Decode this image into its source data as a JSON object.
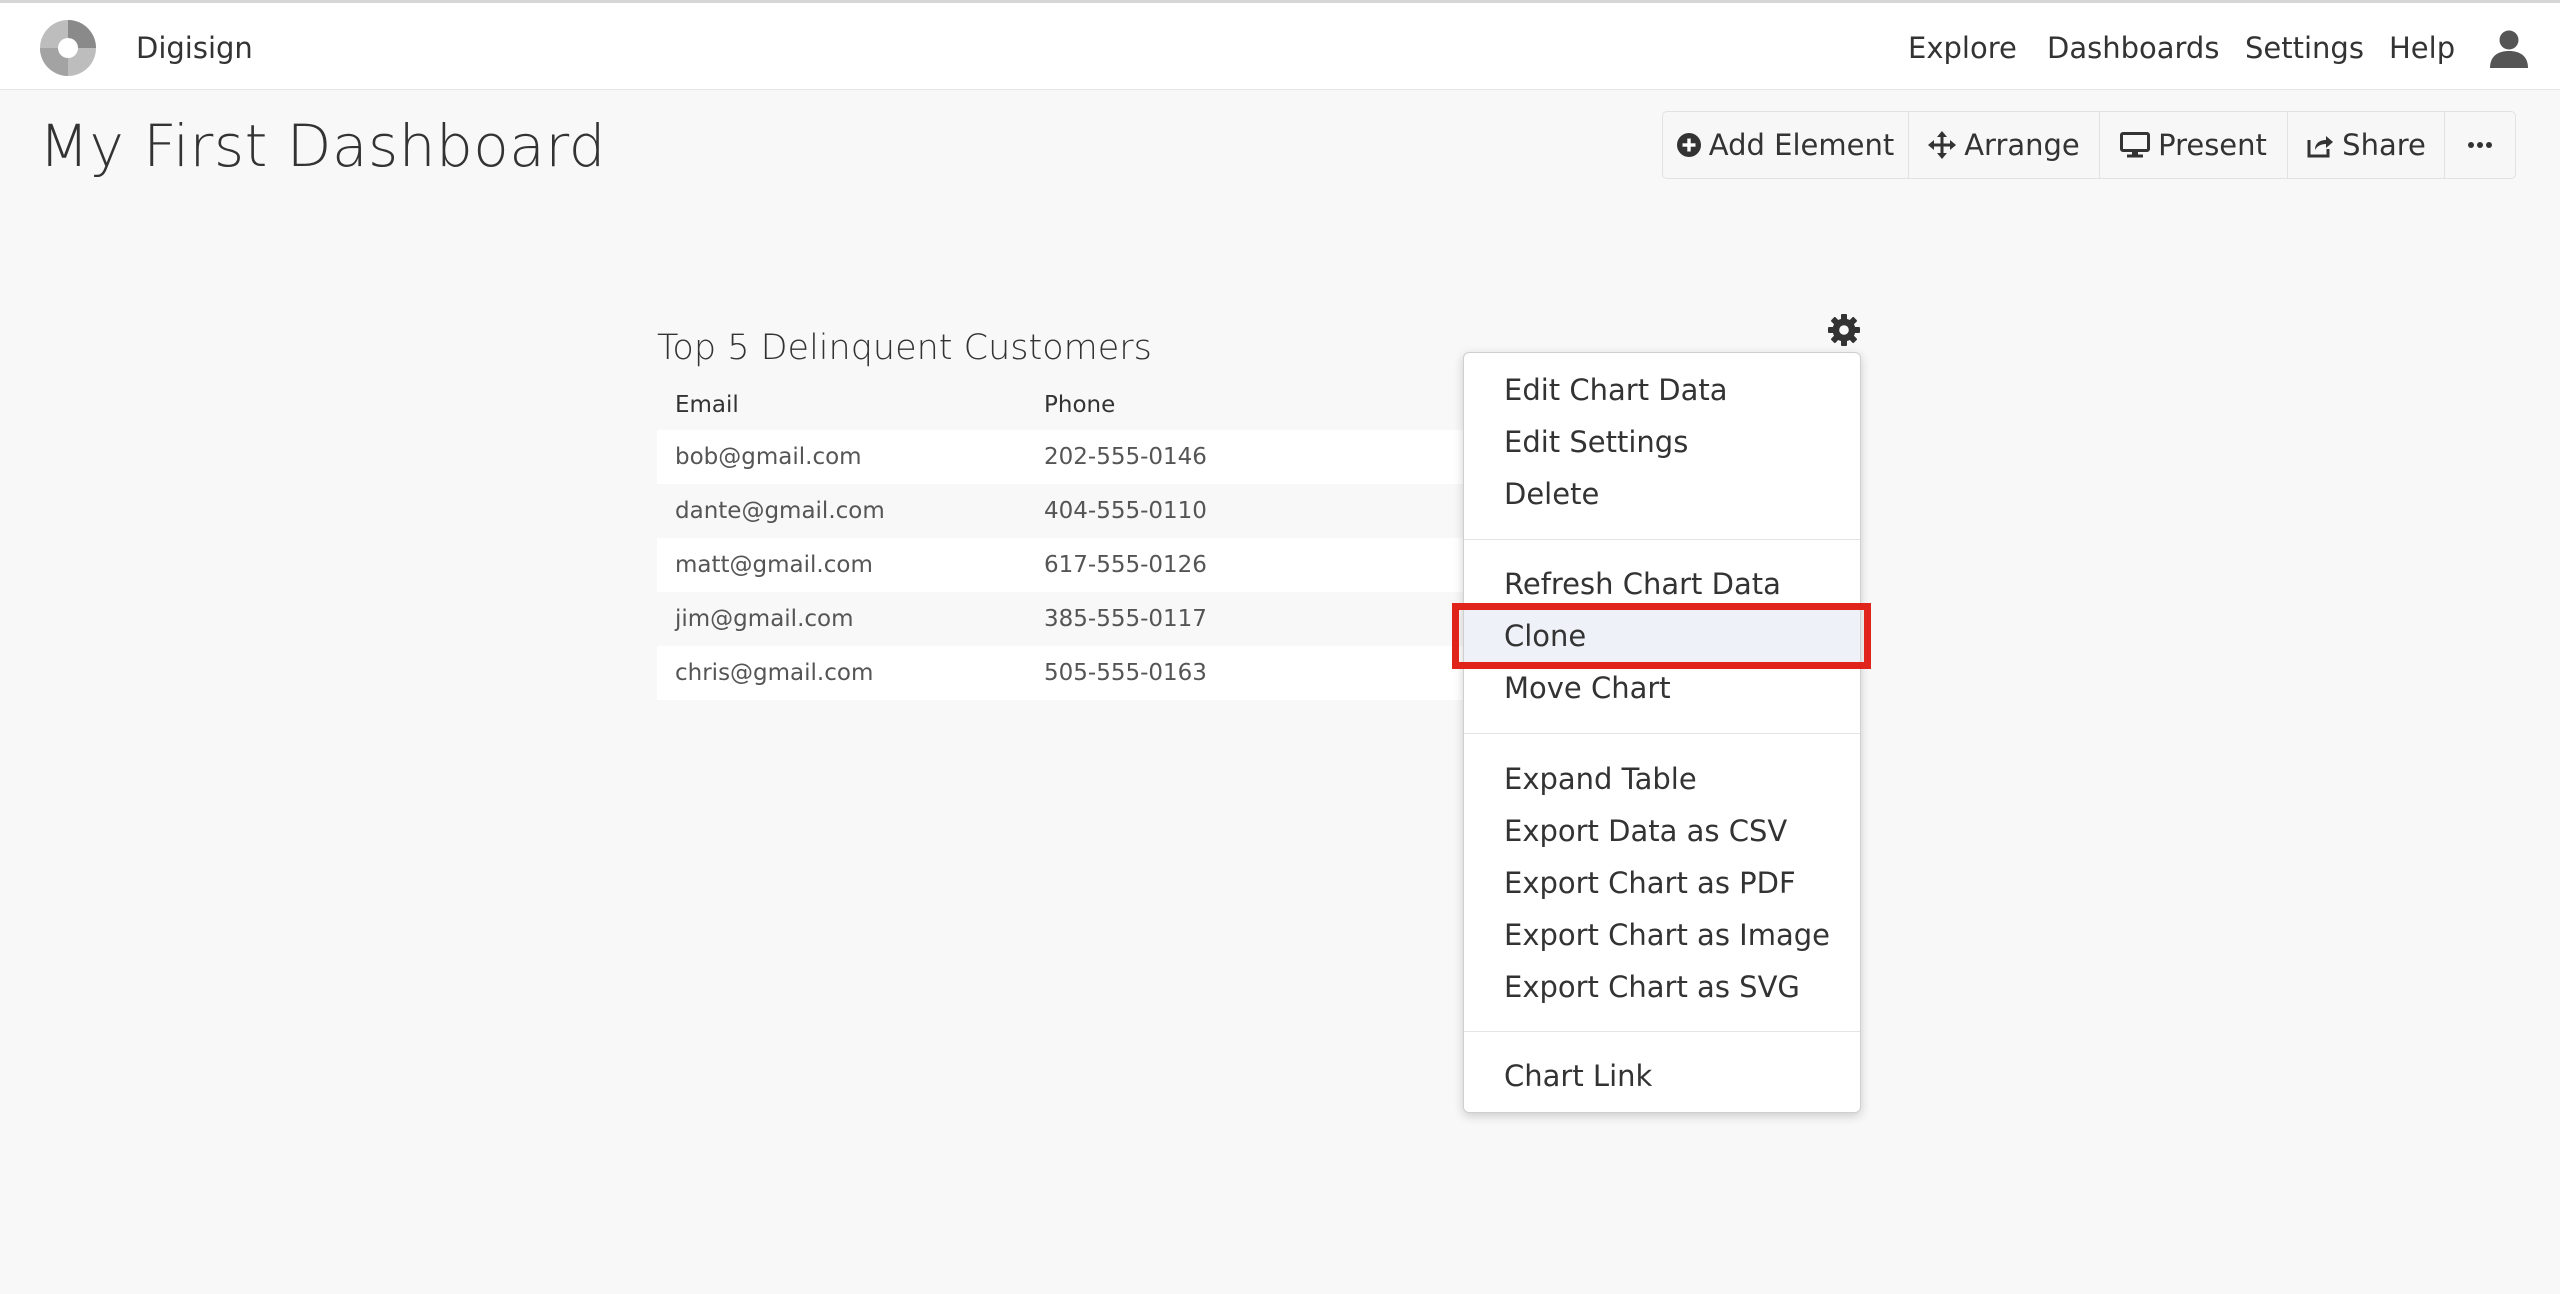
{
  "app": {
    "brand": "Digisign",
    "nav": [
      "Explore",
      "Dashboards",
      "Settings",
      "Help"
    ]
  },
  "page": {
    "title": "My First Dashboard"
  },
  "toolbar": {
    "add_element": "Add Element",
    "arrange": "Arrange",
    "present": "Present",
    "share": "Share"
  },
  "widget": {
    "title": "Top 5 Delinquent Customers",
    "columns": [
      "Email",
      "Phone"
    ],
    "rows": [
      [
        "bob@gmail.com",
        "202-555-0146"
      ],
      [
        "dante@gmail.com",
        "404-555-0110"
      ],
      [
        "matt@gmail.com",
        "617-555-0126"
      ],
      [
        "jim@gmail.com",
        "385-555-0117"
      ],
      [
        "chris@gmail.com",
        "505-555-0163"
      ]
    ]
  },
  "menu": {
    "groups": [
      [
        "Edit Chart Data",
        "Edit Settings",
        "Delete"
      ],
      [
        "Refresh Chart Data",
        "Clone",
        "Move Chart"
      ],
      [
        "Expand Table",
        "Export Data as CSV",
        "Export Chart as PDF",
        "Export Chart as Image",
        "Export Chart as SVG"
      ],
      [
        "Chart Link"
      ]
    ],
    "active_item": "Clone"
  },
  "colors": {
    "highlight": "#e0241b",
    "accent_active": "#eef2f8"
  }
}
